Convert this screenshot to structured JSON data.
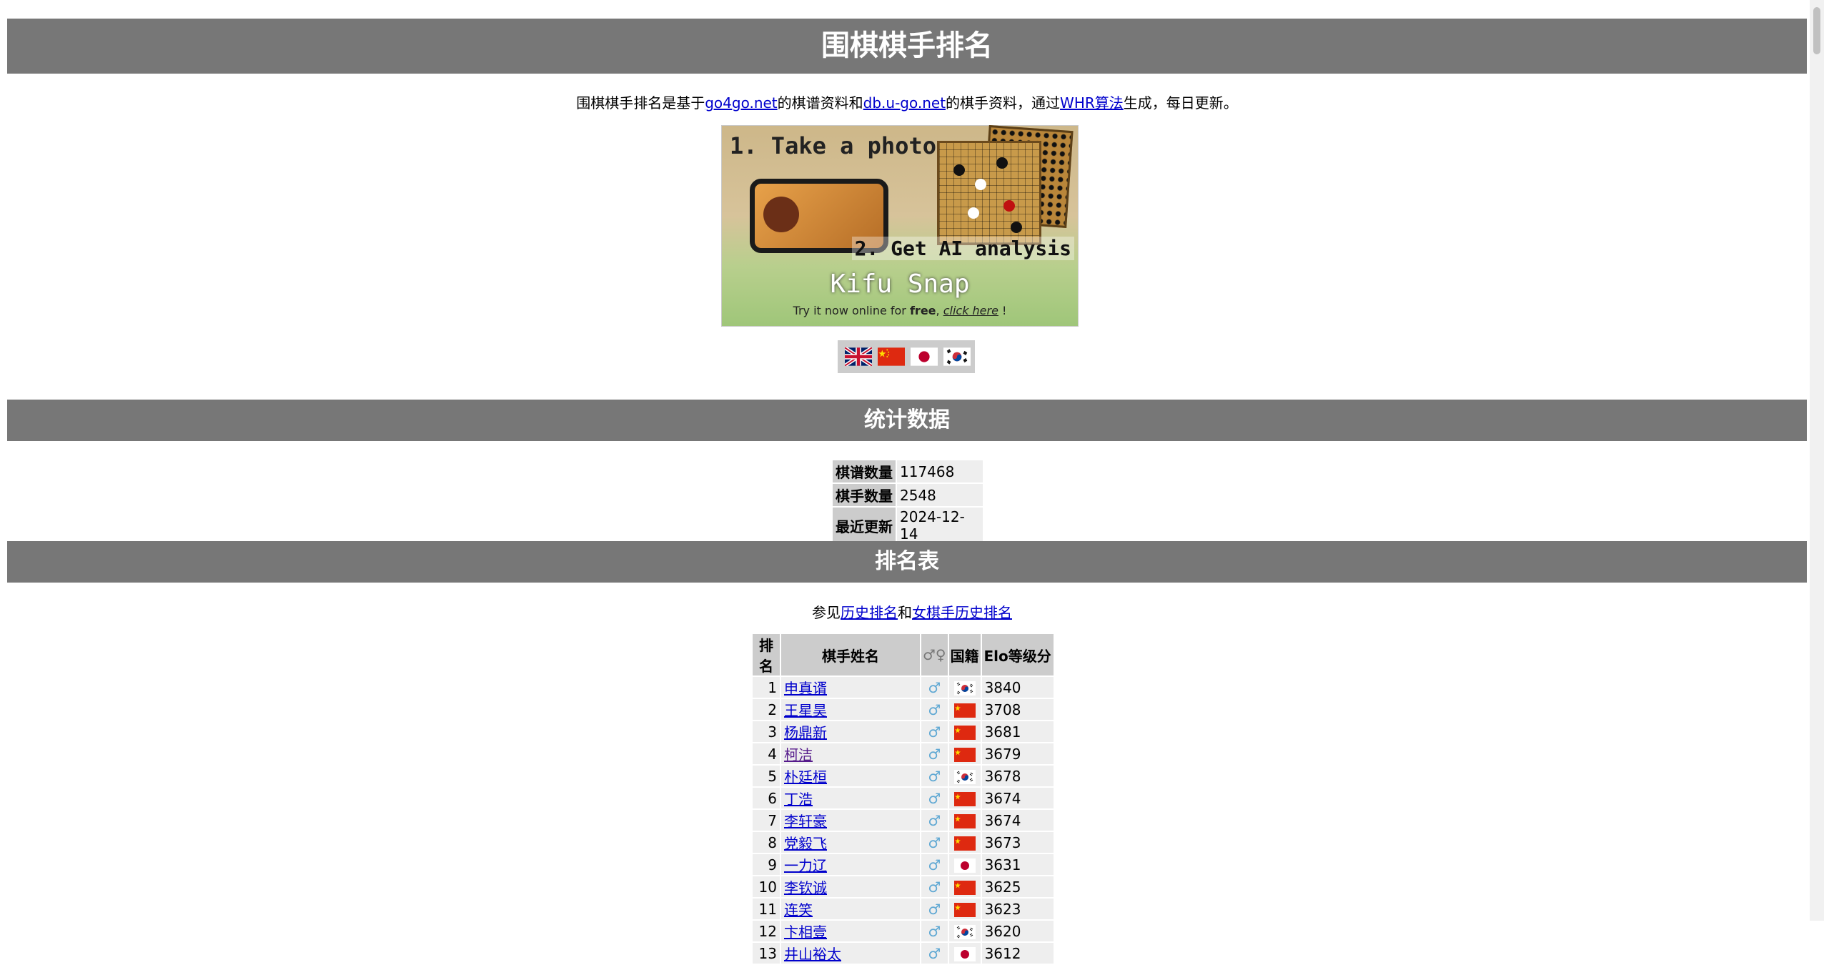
{
  "page": {
    "title": "围棋棋手排名",
    "intro": {
      "t1": "围棋棋手排名是基于",
      "link1": "go4go.net",
      "t2": "的棋谱资料和",
      "link2": "db.u-go.net",
      "t3": "的棋手资料，通过",
      "link3": "WHR算法",
      "t4": "生成，每日更新。"
    }
  },
  "banner": {
    "line1": "1. Take a photo",
    "line2": "2. Get AI analysis",
    "brand": "Kifu Snap",
    "cta_prefix": "Try it now online for ",
    "cta_bold": "free",
    "cta_sep": ", ",
    "cta_link": "click here",
    "cta_end": " !"
  },
  "languages": [
    "english-flag-icon",
    "china-flag-icon",
    "japan-flag-icon",
    "korea-flag-icon"
  ],
  "stats": {
    "heading": "统计数据",
    "rows": [
      {
        "label": "棋谱数量",
        "value": "117468"
      },
      {
        "label": "棋手数量",
        "value": "2548"
      },
      {
        "label": "最近更新",
        "value": "2024-12-14"
      }
    ]
  },
  "ranking": {
    "heading": "排名表",
    "see_prefix": "参见",
    "history_link": "历史排名",
    "see_and": "和",
    "female_link": "女棋手历史排名",
    "columns": {
      "rank": "排名",
      "name": "棋手姓名",
      "sex": "♂♀",
      "nat": "国籍",
      "elo": "Elo等级分"
    },
    "rows": [
      {
        "rank": "1",
        "name": "申真谞",
        "sex": "♂",
        "nat": "korea",
        "elo": "3840"
      },
      {
        "rank": "2",
        "name": "王星昊",
        "sex": "♂",
        "nat": "china",
        "elo": "3708"
      },
      {
        "rank": "3",
        "name": "杨鼎新",
        "sex": "♂",
        "nat": "china",
        "elo": "3681"
      },
      {
        "rank": "4",
        "name": "柯洁",
        "sex": "♂",
        "nat": "china",
        "elo": "3679"
      },
      {
        "rank": "5",
        "name": "朴廷桓",
        "sex": "♂",
        "nat": "korea",
        "elo": "3678"
      },
      {
        "rank": "6",
        "name": "丁浩",
        "sex": "♂",
        "nat": "china",
        "elo": "3674"
      },
      {
        "rank": "7",
        "name": "李轩豪",
        "sex": "♂",
        "nat": "china",
        "elo": "3674"
      },
      {
        "rank": "8",
        "name": "党毅飞",
        "sex": "♂",
        "nat": "china",
        "elo": "3673"
      },
      {
        "rank": "9",
        "name": "一力辽",
        "sex": "♂",
        "nat": "japan",
        "elo": "3631"
      },
      {
        "rank": "10",
        "name": "李钦诚",
        "sex": "♂",
        "nat": "china",
        "elo": "3625"
      },
      {
        "rank": "11",
        "name": "连笑",
        "sex": "♂",
        "nat": "china",
        "elo": "3623"
      },
      {
        "rank": "12",
        "name": "卞相壹",
        "sex": "♂",
        "nat": "korea",
        "elo": "3620"
      },
      {
        "rank": "13",
        "name": "井山裕太",
        "sex": "♂",
        "nat": "japan",
        "elo": "3612"
      }
    ]
  },
  "colors": {
    "bar": "#777777",
    "link": "#0000cc",
    "visited": "#551a8b",
    "male": "#5fa8d3"
  }
}
